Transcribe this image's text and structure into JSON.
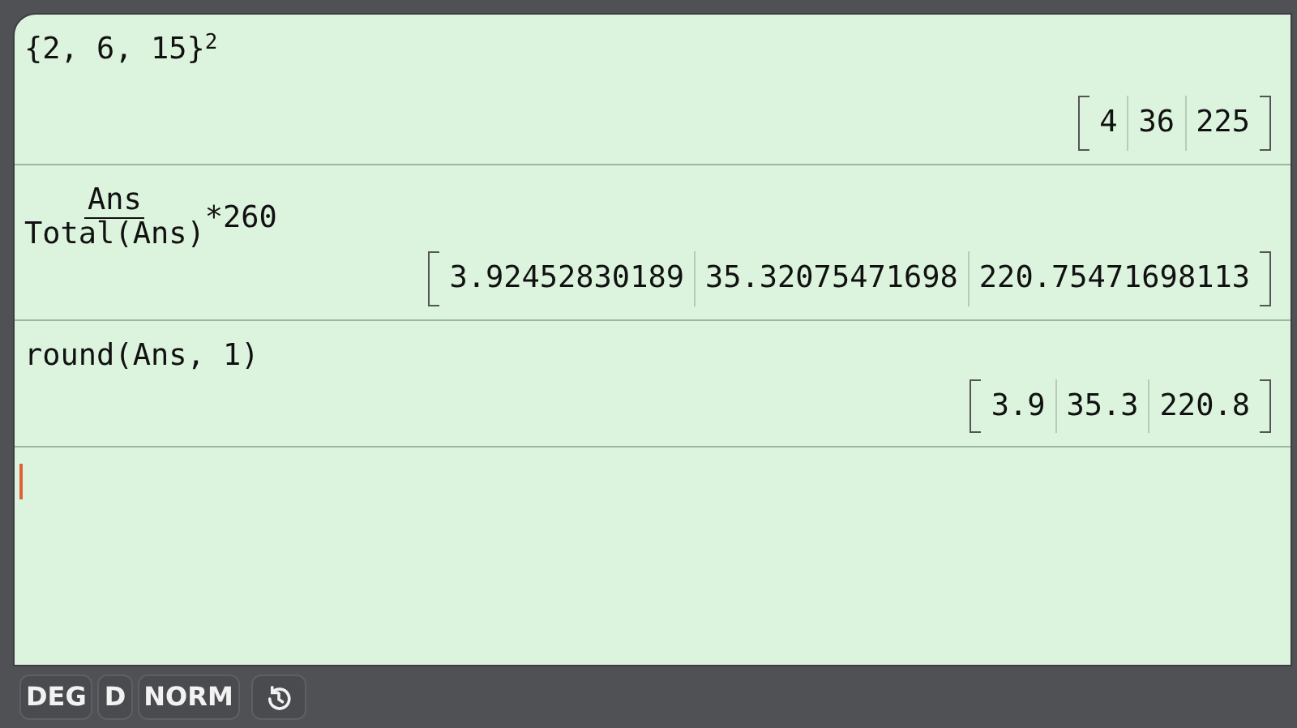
{
  "history": [
    {
      "input": {
        "kind": "text",
        "text": "{2, 6, 15}$^{2}$"
      },
      "result": [
        "4",
        "36",
        "225"
      ]
    },
    {
      "input": {
        "kind": "fraction",
        "numerator": "Ans",
        "denominator": "Total(Ans)",
        "after": "*260"
      },
      "result": [
        "3.92452830189",
        "35.32075471698",
        "220.75471698113"
      ]
    },
    {
      "input": {
        "kind": "text",
        "text": "round(Ans, 1)"
      },
      "result": [
        "3.9",
        "35.3",
        "220.8"
      ]
    }
  ],
  "status_bar": {
    "buttons": [
      {
        "kind": "text",
        "label": "DEG"
      },
      {
        "kind": "text",
        "label": "D"
      },
      {
        "kind": "text",
        "label": "NORM"
      },
      {
        "kind": "history"
      }
    ]
  }
}
